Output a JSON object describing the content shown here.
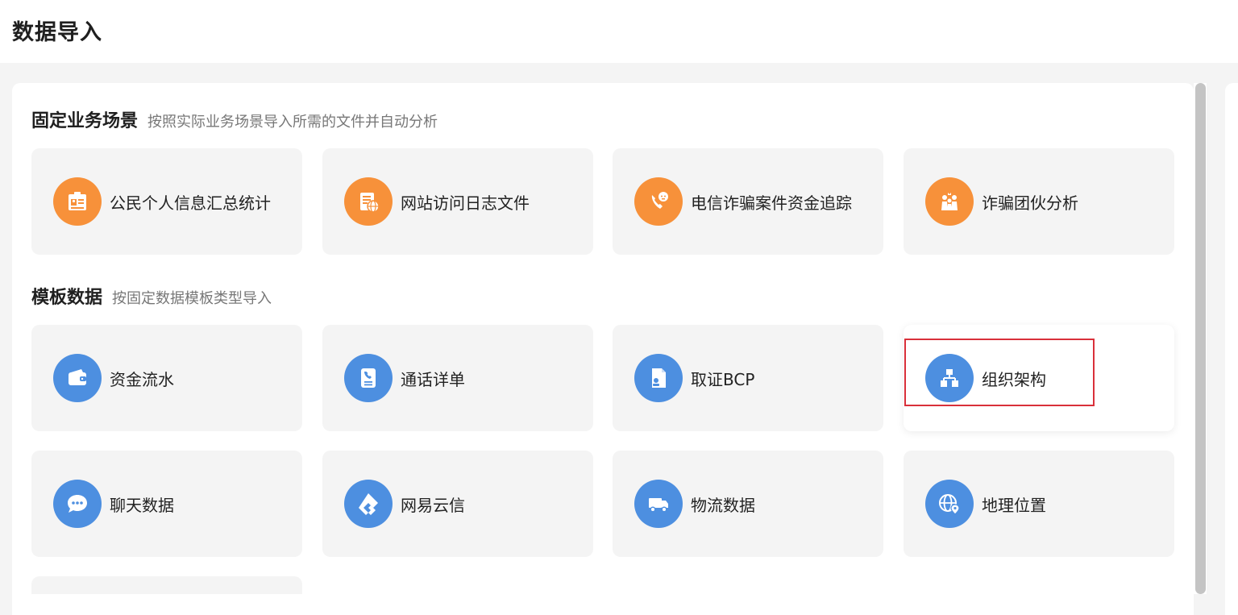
{
  "page_title": "数据导入",
  "sections": {
    "fixed": {
      "title": "固定业务场景",
      "desc": "按照实际业务场景导入所需的文件并自动分析",
      "cards": [
        {
          "label": "公民个人信息汇总统计",
          "icon": "id-card-icon"
        },
        {
          "label": "网站访问日志文件",
          "icon": "web-log-icon"
        },
        {
          "label": "电信诈骗案件资金追踪",
          "icon": "phone-fraud-icon"
        },
        {
          "label": "诈骗团伙分析",
          "icon": "gang-people-icon"
        }
      ]
    },
    "template": {
      "title": "模板数据",
      "desc": "按固定数据模板类型导入",
      "cards": [
        {
          "label": "资金流水",
          "icon": "wallet-icon"
        },
        {
          "label": "通话详单",
          "icon": "call-record-icon"
        },
        {
          "label": "取证BCP",
          "icon": "bcp-file-icon"
        },
        {
          "label": "组织架构",
          "icon": "org-chart-icon"
        },
        {
          "label": "聊天数据",
          "icon": "chat-bubble-icon"
        },
        {
          "label": "网易云信",
          "icon": "netease-yunxin-icon"
        },
        {
          "label": "物流数据",
          "icon": "truck-icon"
        },
        {
          "label": "地理位置",
          "icon": "globe-location-icon"
        }
      ]
    }
  },
  "colors": {
    "orange_icon": "#f7913a",
    "blue_icon": "#4d8fe0",
    "highlight": "#d9303a"
  }
}
